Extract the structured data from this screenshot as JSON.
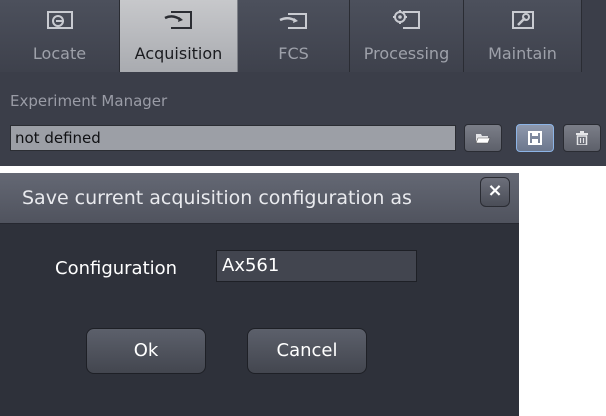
{
  "tabs": [
    {
      "label": "Locate",
      "icon": "locate-icon",
      "active": false
    },
    {
      "label": "Acquisition",
      "icon": "acquisition-icon",
      "active": true
    },
    {
      "label": "FCS",
      "icon": "fcs-icon",
      "active": false
    },
    {
      "label": "Processing",
      "icon": "processing-icon",
      "active": false
    },
    {
      "label": "Maintain",
      "icon": "maintain-icon",
      "active": false
    }
  ],
  "experiment_manager": {
    "title": "Experiment Manager",
    "value": "not defined",
    "buttons": [
      {
        "icon": "folder-open-icon"
      },
      {
        "icon": "save-disk-icon"
      },
      {
        "icon": "trash-icon"
      }
    ]
  },
  "dialog": {
    "title": "Save current acquisition configuration as",
    "close_label": "×",
    "config_label": "Configuration",
    "config_value": "Ax561",
    "ok_label": "Ok",
    "cancel_label": "Cancel"
  },
  "colors": {
    "panel_bg": "#3b3e49",
    "active_tab": "#b8babe",
    "dialog_bg": "#2e313a",
    "button_highlight": "#8cb4e6"
  }
}
